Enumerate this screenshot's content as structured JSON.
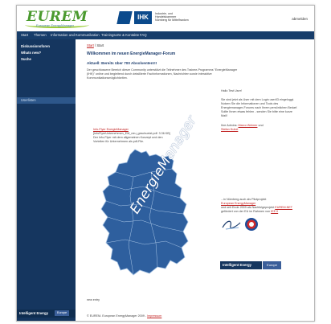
{
  "header": {
    "logo_text": "EUREM",
    "logo_sub": "European EnergyManager",
    "ihk_box": "IHK",
    "ihk_text_1": "Industrie- und Handelskammer",
    "ihk_text_2": "Nürnberg für Mittelfranken",
    "logout": "abmelden"
  },
  "nav": {
    "items": [
      "Start",
      "Themen",
      "Information und Kommunikation",
      "Trainingsorte & Kontakte",
      "FAQ"
    ]
  },
  "sidebar": {
    "items": [
      "Diskussionsforen",
      "Whats new?",
      "Suche"
    ],
    "sub_item": "Userlisten",
    "footer_logo": "Intelligent Energy",
    "footer_eu": "Europe"
  },
  "content": {
    "breadcrumb_link": "Start",
    "breadcrumb_sep": " / ",
    "breadcrumb_current": "Start",
    "title": "Willkommen im neuen EnergieManager-Forum",
    "subtitle": "Aktuell: Bereits über 700 Absolventen!!!",
    "intro_1": "Der geschlossene Bereich dieser Community unterstützt die Teilnehmer des Trainee-Programms \"EnergieManager",
    "intro_2": "(IHK)\" online und begleitend durch detaillierte Fachinformationen, Nachrichten sowie interaktive",
    "intro_3": "Kommunikationsmöglichkeiten.",
    "hello": "Hallo Test User!",
    "right_1": "Sie sind jetzt als User mit dem Login user03 eingeloggt.",
    "right_2": "Nutzen Sie die Informationen und Tools des",
    "right_3": "Energiemanager-Forums nach Ihrem persönlichen Bedarf.",
    "right_4": "Sollte Ihnen etwas fehlen - senden Sie bitte eine kurze",
    "right_5": "Mail!",
    "admin_prefix": "Ihre Admins: ",
    "admin_1": "Marco Weimer",
    "admin_and": " und",
    "admin_2": "Stefan Hubel",
    "flyer_link": "Info-Flyer EnergieManager",
    "flyer_1": "[InfoFlyerUnternehmen_EM_neu_geschuetzt.pdf: 3.36 KB]",
    "flyer_2": "Der Info-Flyer mit dem allgemeinen Konzept und den",
    "flyer_3": "Vorteilen für Unternehmen als pdf-File.",
    "map_text": "EnergieManager",
    "nbg_1": "...in Nürnberg auch als Pilotprojekt",
    "nbg_link": "European EnergyManager",
    "nbg_2": "und seit Ende 2009 als Nachfolgeprojekt",
    "nbg_link2": "EUREM.NET",
    "nbg_3": "gefördert von der EU im Rahmen von",
    "nbg_link3": "IEE II",
    "ie_band_a": "Intelligent Energy",
    "ie_band_b": "Europe",
    "bottom_note": "new entry",
    "footer_text": "© EUREM- European EnergyManager 2009 - ",
    "footer_link": "Impressum"
  }
}
